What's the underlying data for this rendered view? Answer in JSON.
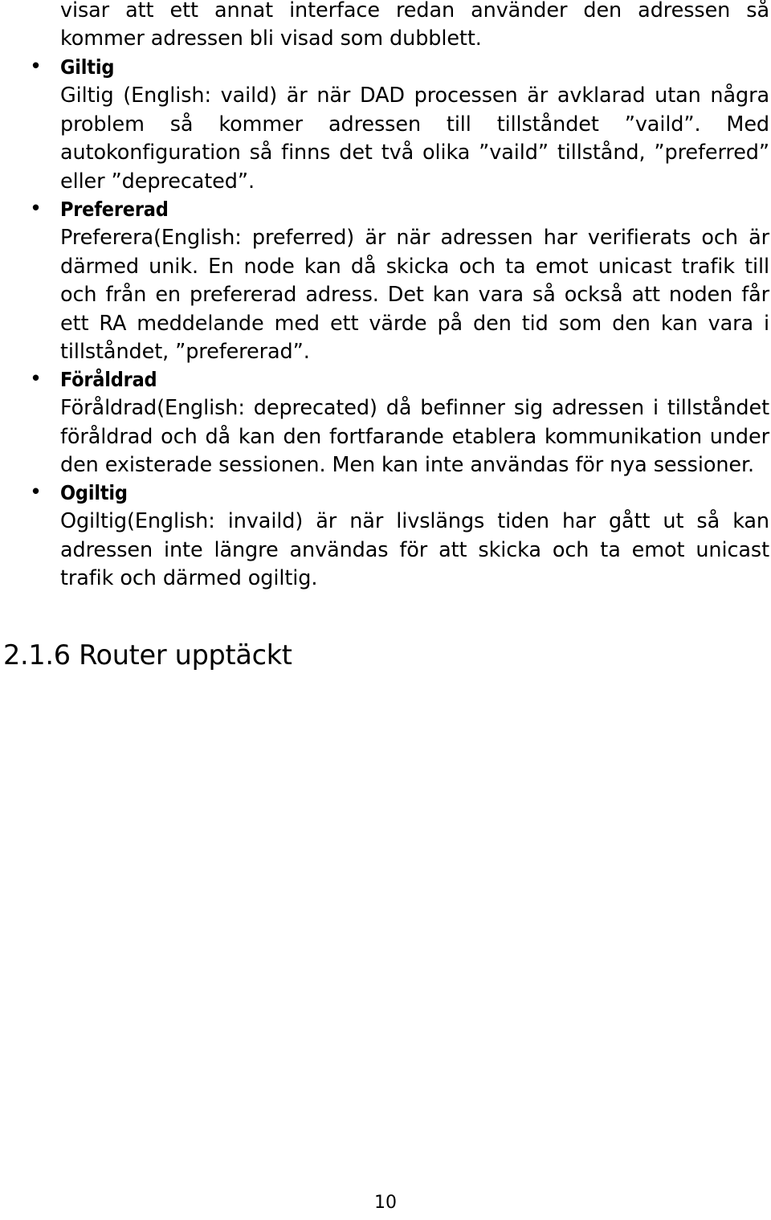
{
  "document": {
    "language": "sv",
    "page_number": "10",
    "intro_paragraph": "visar att ett annat interface redan använder den adressen så kommer adressen bli visad som dubblett.",
    "bullet_glyph": "•",
    "bullets": [
      {
        "label": "Giltig",
        "body": "Giltig (English: vaild) är när DAD processen är avklarad utan några problem så kommer adressen till tillståndet ”vaild”.  Med autokonfiguration så finns det två olika ”vaild” tillstånd, ”preferred” eller ”deprecated”."
      },
      {
        "label": "Prefererad",
        "body": "Preferera(English: preferred) är när adressen har verifierats och är därmed unik. En node kan då skicka och ta emot unicast trafik till och från en prefererad adress. Det kan vara så också att noden får ett RA meddelande med ett värde på den tid som den kan vara i tillståndet, ”prefererad”."
      },
      {
        "label": "Föråldrad",
        "body": "Föråldrad(English: deprecated) då befinner sig adressen i tillståndet föråldrad och då kan den fortfarande etablera kommunikation under den existerade sessionen. Men kan inte användas för nya sessioner."
      },
      {
        "label": "Ogiltig",
        "body": "Ogiltig(English: invaild) är när livslängs tiden har gått ut så kan adressen inte längre användas för att skicka och ta emot unicast trafik och därmed ogiltig."
      }
    ],
    "section_heading": "2.1.6 Router upptäckt",
    "colors": {
      "text": "#000000",
      "background": "#ffffff"
    }
  }
}
